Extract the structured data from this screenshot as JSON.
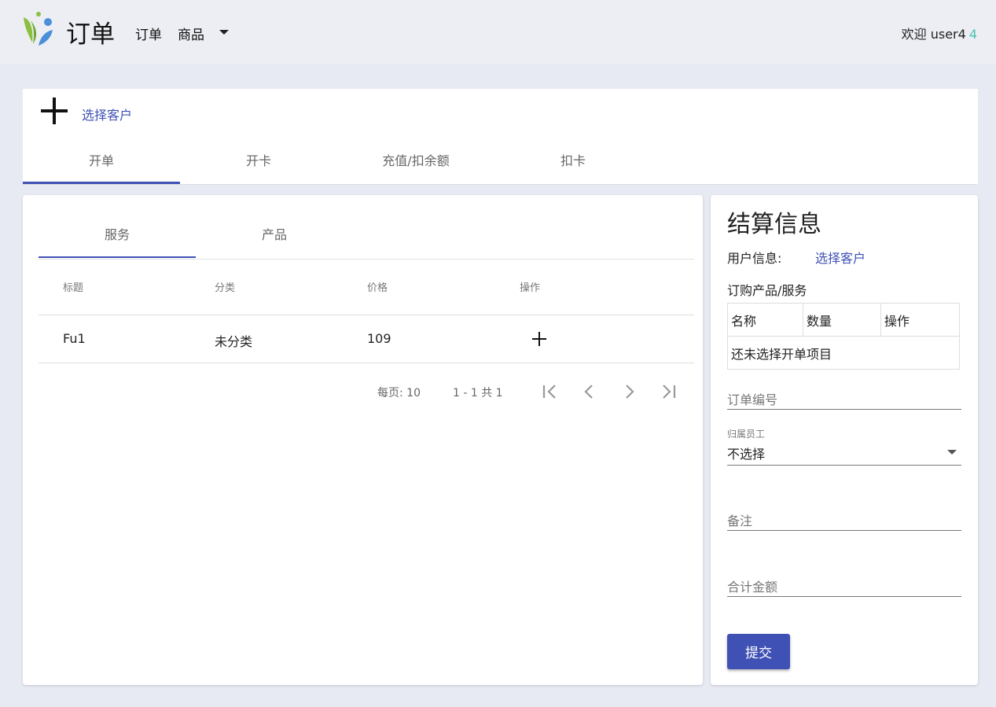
{
  "header": {
    "title": "订单",
    "nav": [
      {
        "label": "订单"
      },
      {
        "label": "商品"
      }
    ],
    "welcome": "欢迎 user4",
    "badge": "4"
  },
  "top_card": {
    "select_customer": "选择客户",
    "tabs": [
      {
        "label": "开单",
        "active": true
      },
      {
        "label": "开卡",
        "active": false
      },
      {
        "label": "充值/扣余额",
        "active": false
      },
      {
        "label": "扣卡",
        "active": false
      }
    ]
  },
  "catalog": {
    "tabs": [
      {
        "label": "服务",
        "active": true
      },
      {
        "label": "产品",
        "active": false
      }
    ],
    "columns": [
      "标题",
      "分类",
      "价格",
      "操作"
    ],
    "rows": [
      {
        "title": "Fu1",
        "category": "未分类",
        "price": "109"
      }
    ],
    "pager": {
      "per_page": "每页: 10",
      "range": "1 - 1 共 1"
    }
  },
  "settlement": {
    "title": "结算信息",
    "user_info_label": "用户信息:",
    "select_customer": "选择客户",
    "order_items_label": "订购产品/服务",
    "items_columns": [
      "名称",
      "数量",
      "操作"
    ],
    "items_empty": "还未选择开单项目",
    "order_no_placeholder": "订单编号",
    "staff_label": "归属员工",
    "staff_value": "不选择",
    "remark_placeholder": "备注",
    "total_placeholder": "合计金额",
    "submit_label": "提交"
  },
  "colors": {
    "accent": "#3f51b5",
    "badge": "#4bbfae"
  }
}
